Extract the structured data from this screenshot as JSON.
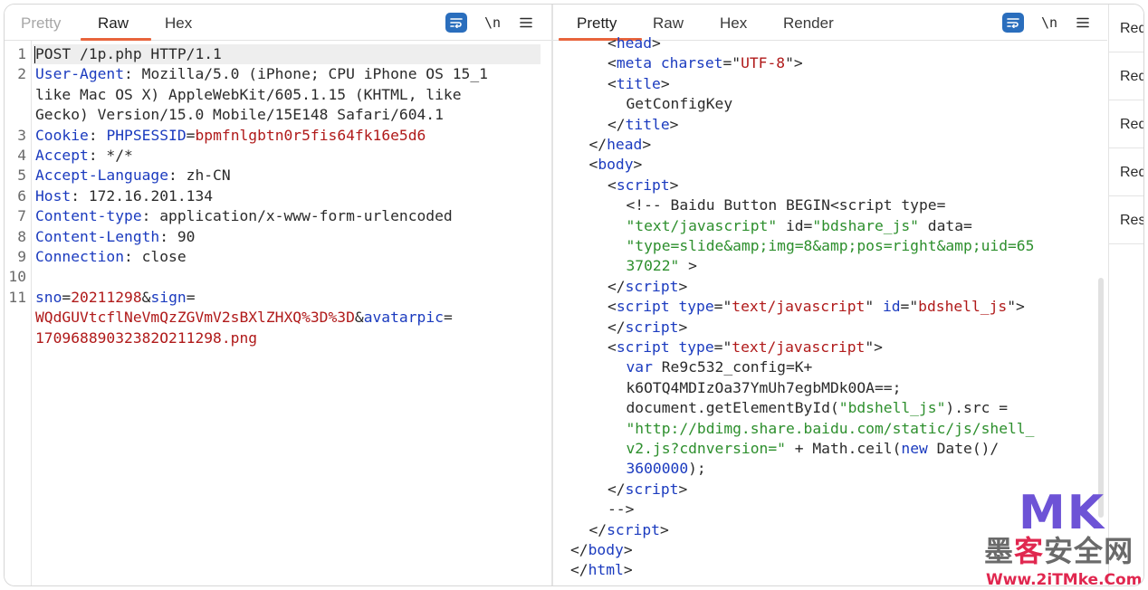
{
  "request_pane": {
    "tabs": [
      "Pretty",
      "Raw",
      "Hex"
    ],
    "active_tab": "Raw",
    "newline_label": "\\n",
    "lines": [
      {
        "n": "1",
        "parts": [
          [
            "t",
            "POST /1p.php HTTP/1.1"
          ]
        ]
      },
      {
        "n": "2",
        "parts": [
          [
            "k",
            "User-Agent"
          ],
          [
            "t",
            ": Mozilla/5.0 (iPhone; CPU iPhone OS 15_1"
          ]
        ]
      },
      {
        "n": "",
        "parts": [
          [
            "t",
            "like Mac OS X) AppleWebKit/605.1.15 (KHTML, like"
          ]
        ]
      },
      {
        "n": "",
        "parts": [
          [
            "t",
            "Gecko) Version/15.0 Mobile/15E148 Safari/604.1"
          ]
        ]
      },
      {
        "n": "3",
        "parts": [
          [
            "k",
            "Cookie"
          ],
          [
            "t",
            ": "
          ],
          [
            "k",
            "PHPSESSID"
          ],
          [
            "t",
            "="
          ],
          [
            "v",
            "bpmfnlgbtn0r5fis64fk16e5d6"
          ]
        ]
      },
      {
        "n": "4",
        "parts": [
          [
            "k",
            "Accept"
          ],
          [
            "t",
            ": */*"
          ]
        ]
      },
      {
        "n": "5",
        "parts": [
          [
            "k",
            "Accept-Language"
          ],
          [
            "t",
            ": zh-CN"
          ]
        ]
      },
      {
        "n": "6",
        "parts": [
          [
            "k",
            "Host"
          ],
          [
            "t",
            ": 172.16.201.134"
          ]
        ]
      },
      {
        "n": "7",
        "parts": [
          [
            "k",
            "Content-type"
          ],
          [
            "t",
            ": application/x-www-form-urlencoded"
          ]
        ]
      },
      {
        "n": "8",
        "parts": [
          [
            "k",
            "Content-Length"
          ],
          [
            "t",
            ": 90"
          ]
        ]
      },
      {
        "n": "9",
        "parts": [
          [
            "k",
            "Connection"
          ],
          [
            "t",
            ": close"
          ]
        ]
      },
      {
        "n": "10",
        "parts": []
      },
      {
        "n": "11",
        "parts": [
          [
            "k",
            "sno"
          ],
          [
            "t",
            "="
          ],
          [
            "v",
            "20211298"
          ],
          [
            "t",
            "&"
          ],
          [
            "k",
            "sign"
          ],
          [
            "t",
            "="
          ]
        ]
      },
      {
        "n": "",
        "parts": [
          [
            "v",
            "WQdGUVtcflNeVmQzZGVmV2sBXlZHXQ%3D%3D"
          ],
          [
            "t",
            "&"
          ],
          [
            "k",
            "avatarpic"
          ],
          [
            "t",
            "="
          ]
        ]
      },
      {
        "n": "",
        "parts": [
          [
            "v",
            "17096889032382O211298.png"
          ]
        ]
      }
    ]
  },
  "response_pane": {
    "tabs": [
      "Pretty",
      "Raw",
      "Hex",
      "Render"
    ],
    "active_tab": "Pretty",
    "newline_label": "\\n",
    "lines": [
      {
        "indent": 2,
        "parts": [
          [
            "t",
            "<"
          ],
          [
            "tg",
            "head"
          ],
          [
            "t",
            ">"
          ]
        ]
      },
      {
        "indent": 2,
        "parts": [
          [
            "t",
            "<"
          ],
          [
            "tg",
            "meta"
          ],
          [
            "t",
            " "
          ],
          [
            "at",
            "charset"
          ],
          [
            "t",
            "=\""
          ],
          [
            "s",
            "UTF-8"
          ],
          [
            "t",
            "\">"
          ]
        ]
      },
      {
        "indent": 2,
        "parts": [
          [
            "t",
            "<"
          ],
          [
            "tg",
            "title"
          ],
          [
            "t",
            ">"
          ]
        ]
      },
      {
        "indent": 3,
        "parts": [
          [
            "t",
            "GetConfigKey"
          ]
        ]
      },
      {
        "indent": 2,
        "parts": [
          [
            "t",
            "</"
          ],
          [
            "tg",
            "title"
          ],
          [
            "t",
            ">"
          ]
        ]
      },
      {
        "indent": 1,
        "parts": [
          [
            "t",
            "</"
          ],
          [
            "tg",
            "head"
          ],
          [
            "t",
            ">"
          ]
        ]
      },
      {
        "indent": 1,
        "parts": [
          [
            "t",
            "<"
          ],
          [
            "tg",
            "body"
          ],
          [
            "t",
            ">"
          ]
        ]
      },
      {
        "indent": 2,
        "parts": [
          [
            "t",
            "<"
          ],
          [
            "tg",
            "script"
          ],
          [
            "t",
            ">"
          ]
        ]
      },
      {
        "indent": 3,
        "parts": [
          [
            "t",
            "<!-- Baidu Button BEGIN<script type="
          ]
        ]
      },
      {
        "indent": 3,
        "parts": [
          [
            "cm",
            "\"text/javascript\""
          ],
          [
            "t",
            " id="
          ],
          [
            "cm",
            "\"bdshare_js\""
          ],
          [
            "t",
            " data="
          ]
        ]
      },
      {
        "indent": 3,
        "parts": [
          [
            "cm",
            "\"type=slide&amp;img=8&amp;pos=right&amp;uid=65"
          ]
        ]
      },
      {
        "indent": 3,
        "parts": [
          [
            "cm",
            "37022\""
          ],
          [
            "t",
            " >"
          ]
        ]
      },
      {
        "indent": 2,
        "parts": [
          [
            "t",
            "</"
          ],
          [
            "tg",
            "script"
          ],
          [
            "t",
            ">"
          ]
        ]
      },
      {
        "indent": 2,
        "parts": [
          [
            "t",
            "<"
          ],
          [
            "tg",
            "script"
          ],
          [
            "t",
            " "
          ],
          [
            "at",
            "type"
          ],
          [
            "t",
            "=\""
          ],
          [
            "s",
            "text/javascript"
          ],
          [
            "t",
            "\" "
          ],
          [
            "at",
            "id"
          ],
          [
            "t",
            "=\""
          ],
          [
            "s",
            "bdshell_js"
          ],
          [
            "t",
            "\">"
          ]
        ]
      },
      {
        "indent": 2,
        "parts": [
          [
            "t",
            "</"
          ],
          [
            "tg",
            "script"
          ],
          [
            "t",
            ">"
          ]
        ]
      },
      {
        "indent": 2,
        "parts": [
          [
            "t",
            "<"
          ],
          [
            "tg",
            "script"
          ],
          [
            "t",
            " "
          ],
          [
            "at",
            "type"
          ],
          [
            "t",
            "=\""
          ],
          [
            "s",
            "text/javascript"
          ],
          [
            "t",
            "\">"
          ]
        ]
      },
      {
        "indent": 3,
        "parts": [
          [
            "nb",
            "var"
          ],
          [
            "t",
            " Re9c532_config=K+"
          ]
        ]
      },
      {
        "indent": 3,
        "parts": [
          [
            "t",
            "k6OTQ4MDIzOa37YmUh7egbMDk0OA==;"
          ]
        ]
      },
      {
        "indent": 3,
        "parts": [
          [
            "t",
            "document.getElementById("
          ],
          [
            "cm",
            "\"bdshell_js\""
          ],
          [
            "t",
            ").src ="
          ]
        ]
      },
      {
        "indent": 3,
        "parts": [
          [
            "cm",
            "\"http://bdimg.share.baidu.com/static/js/shell_"
          ]
        ]
      },
      {
        "indent": 3,
        "parts": [
          [
            "cm",
            "v2.js?cdnversion=\""
          ],
          [
            "t",
            " + Math.ceil("
          ],
          [
            "nb",
            "new"
          ],
          [
            "t",
            " Date()/"
          ]
        ]
      },
      {
        "indent": 3,
        "parts": [
          [
            "nb",
            "3600000"
          ],
          [
            "t",
            ");"
          ]
        ]
      },
      {
        "indent": 2,
        "parts": [
          [
            "t",
            "</"
          ],
          [
            "tg",
            "script"
          ],
          [
            "t",
            ">"
          ]
        ]
      },
      {
        "indent": 2,
        "parts": [
          [
            "t",
            "-->"
          ]
        ]
      },
      {
        "indent": 1,
        "parts": [
          [
            "t",
            "</"
          ],
          [
            "tg",
            "script"
          ],
          [
            "t",
            ">"
          ]
        ]
      },
      {
        "indent": 0,
        "parts": [
          [
            "t",
            "</"
          ],
          [
            "tg",
            "body"
          ],
          [
            "t",
            ">"
          ]
        ]
      },
      {
        "indent": 0,
        "parts": [
          [
            "t",
            "</"
          ],
          [
            "tg",
            "html"
          ],
          [
            "t",
            ">"
          ]
        ]
      }
    ]
  },
  "side_panel": {
    "items": [
      "Req",
      "Req",
      "Req",
      "Req",
      "Res"
    ]
  },
  "watermark": {
    "logo": "MK",
    "cn_text": "墨客安全网",
    "url": "Www.2iTMke.Com"
  },
  "colors": {
    "accent": "#e8643c",
    "wrap_button": "#2a6ebd",
    "watermark_purple": "#6d53d6",
    "watermark_red": "#e0274f"
  }
}
